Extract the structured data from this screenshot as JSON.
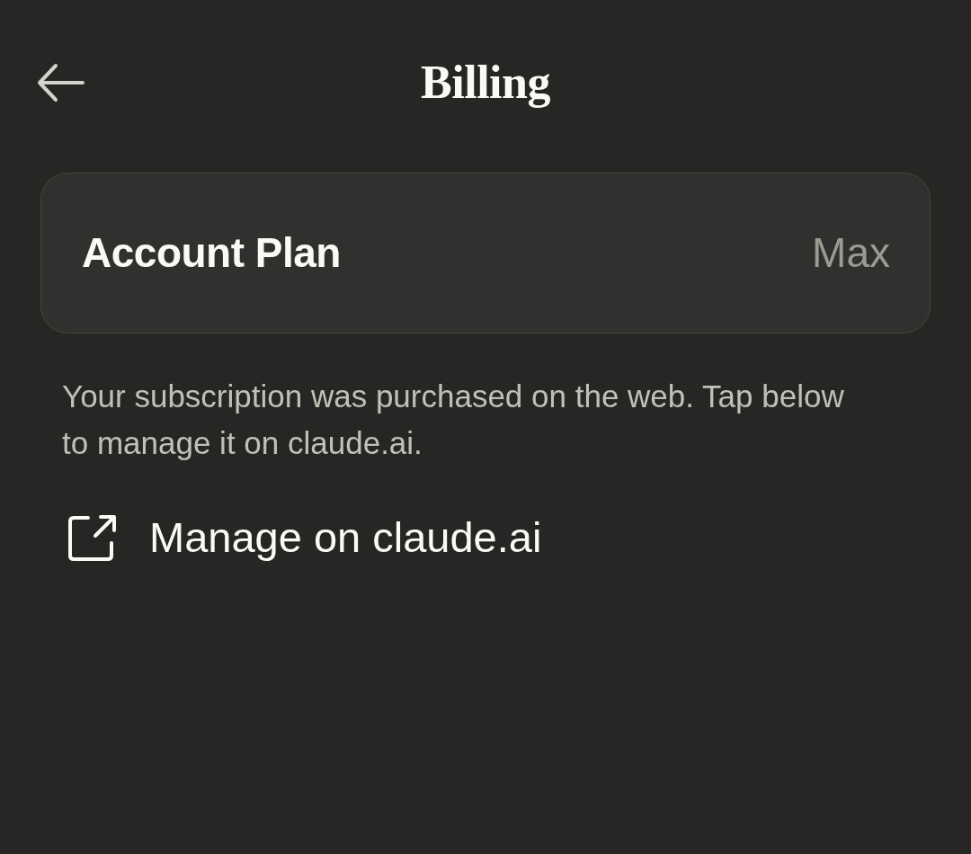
{
  "header": {
    "title": "Billing"
  },
  "plan_card": {
    "label": "Account Plan",
    "value": "Max"
  },
  "description": "Your subscription was purchased on the web. Tap below to manage it on claude.ai.",
  "manage_link": {
    "label": "Manage on claude.ai"
  }
}
